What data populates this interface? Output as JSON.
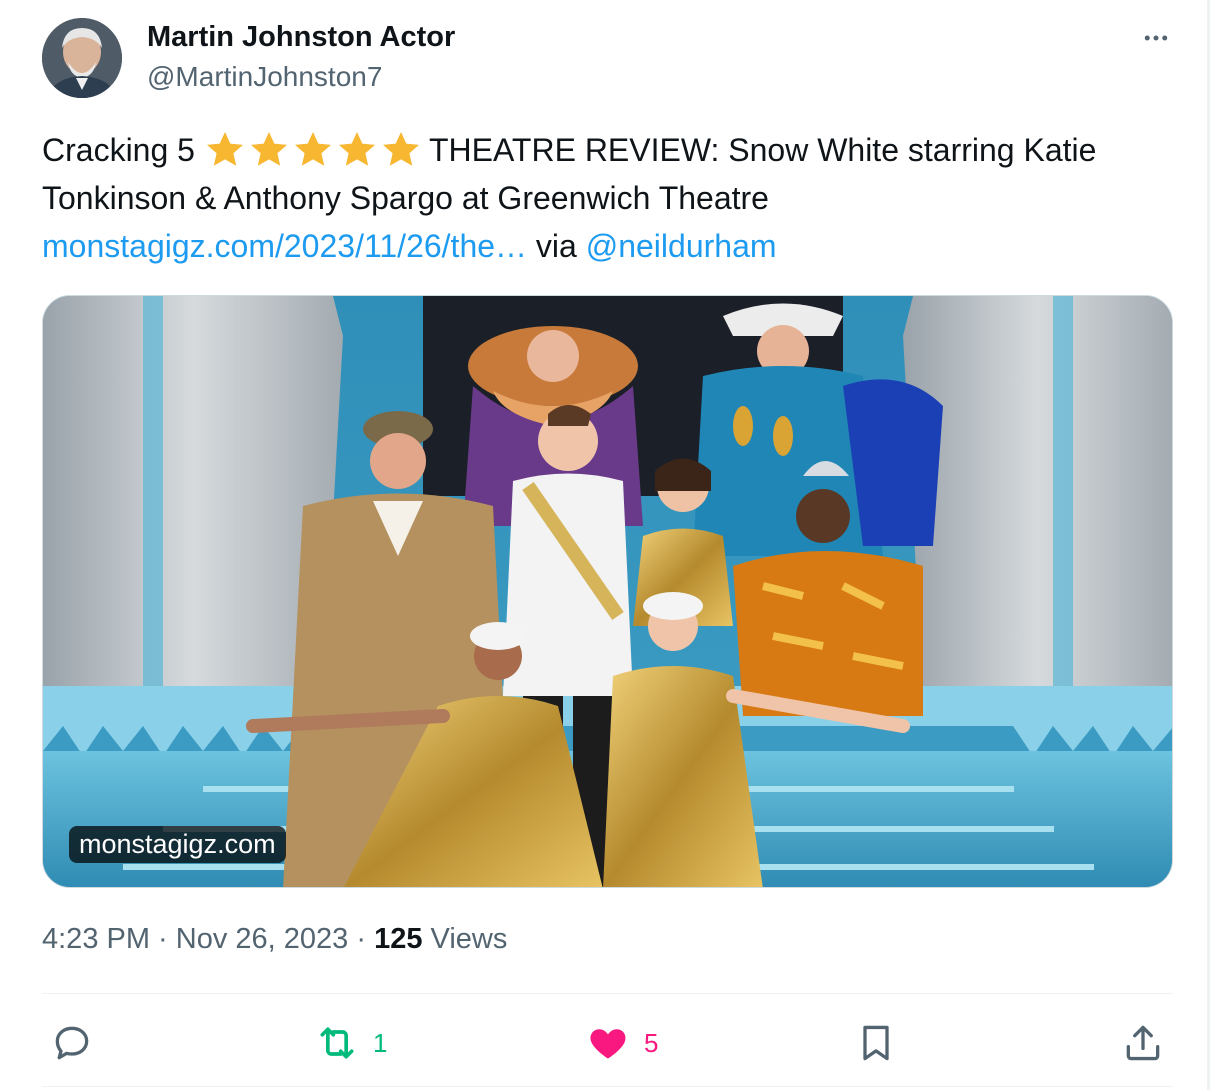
{
  "author": {
    "display_name": "Martin Johnston Actor",
    "handle": "@MartinJohnston7"
  },
  "tweet": {
    "prefix": "Cracking  5",
    "stars": 5,
    "headline_rest": "THEATRE REVIEW: Snow White starring Katie",
    "line2": "Tonkinson & Anthony Spargo at Greenwich Theatre",
    "link_text": "monstagigz.com/2023/11/26/the…",
    "via_text": " via ",
    "mention": "@neildurham"
  },
  "media": {
    "domain_badge": "monstagigz.com"
  },
  "meta": {
    "time": "4:23 PM",
    "separator": " · ",
    "date": "Nov 26, 2023",
    "views_count": "125",
    "views_label": " Views"
  },
  "actions": {
    "reply_count": "",
    "retweet_count": "1",
    "like_count": "5"
  },
  "colors": {
    "link": "#1d9bf0",
    "retweet_green": "#00ba7c",
    "like_pink": "#f91880",
    "muted": "#536471",
    "star": "#f7b731"
  },
  "icons": {
    "more": "more-icon",
    "reply": "reply-icon",
    "retweet": "retweet-icon",
    "like": "heart-icon",
    "bookmark": "bookmark-icon",
    "share": "share-icon"
  }
}
